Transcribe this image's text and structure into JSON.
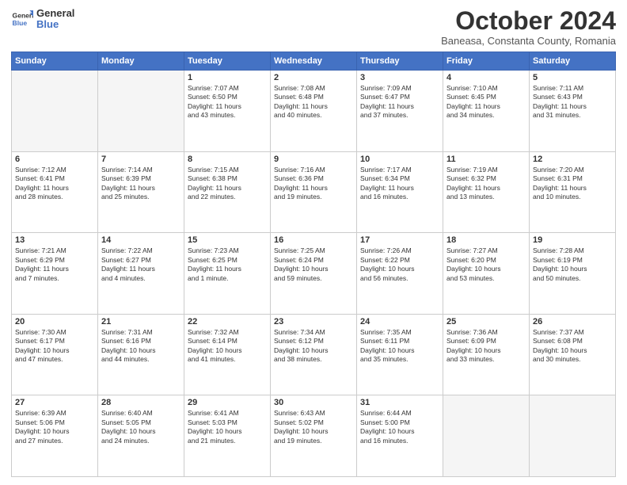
{
  "header": {
    "logo_general": "General",
    "logo_blue": "Blue",
    "month_title": "October 2024",
    "location": "Baneasa, Constanta County, Romania"
  },
  "days_of_week": [
    "Sunday",
    "Monday",
    "Tuesday",
    "Wednesday",
    "Thursday",
    "Friday",
    "Saturday"
  ],
  "weeks": [
    [
      {
        "day": "",
        "empty": true
      },
      {
        "day": "",
        "empty": true
      },
      {
        "day": "1",
        "line1": "Sunrise: 7:07 AM",
        "line2": "Sunset: 6:50 PM",
        "line3": "Daylight: 11 hours",
        "line4": "and 43 minutes."
      },
      {
        "day": "2",
        "line1": "Sunrise: 7:08 AM",
        "line2": "Sunset: 6:48 PM",
        "line3": "Daylight: 11 hours",
        "line4": "and 40 minutes."
      },
      {
        "day": "3",
        "line1": "Sunrise: 7:09 AM",
        "line2": "Sunset: 6:47 PM",
        "line3": "Daylight: 11 hours",
        "line4": "and 37 minutes."
      },
      {
        "day": "4",
        "line1": "Sunrise: 7:10 AM",
        "line2": "Sunset: 6:45 PM",
        "line3": "Daylight: 11 hours",
        "line4": "and 34 minutes."
      },
      {
        "day": "5",
        "line1": "Sunrise: 7:11 AM",
        "line2": "Sunset: 6:43 PM",
        "line3": "Daylight: 11 hours",
        "line4": "and 31 minutes."
      }
    ],
    [
      {
        "day": "6",
        "line1": "Sunrise: 7:12 AM",
        "line2": "Sunset: 6:41 PM",
        "line3": "Daylight: 11 hours",
        "line4": "and 28 minutes."
      },
      {
        "day": "7",
        "line1": "Sunrise: 7:14 AM",
        "line2": "Sunset: 6:39 PM",
        "line3": "Daylight: 11 hours",
        "line4": "and 25 minutes."
      },
      {
        "day": "8",
        "line1": "Sunrise: 7:15 AM",
        "line2": "Sunset: 6:38 PM",
        "line3": "Daylight: 11 hours",
        "line4": "and 22 minutes."
      },
      {
        "day": "9",
        "line1": "Sunrise: 7:16 AM",
        "line2": "Sunset: 6:36 PM",
        "line3": "Daylight: 11 hours",
        "line4": "and 19 minutes."
      },
      {
        "day": "10",
        "line1": "Sunrise: 7:17 AM",
        "line2": "Sunset: 6:34 PM",
        "line3": "Daylight: 11 hours",
        "line4": "and 16 minutes."
      },
      {
        "day": "11",
        "line1": "Sunrise: 7:19 AM",
        "line2": "Sunset: 6:32 PM",
        "line3": "Daylight: 11 hours",
        "line4": "and 13 minutes."
      },
      {
        "day": "12",
        "line1": "Sunrise: 7:20 AM",
        "line2": "Sunset: 6:31 PM",
        "line3": "Daylight: 11 hours",
        "line4": "and 10 minutes."
      }
    ],
    [
      {
        "day": "13",
        "line1": "Sunrise: 7:21 AM",
        "line2": "Sunset: 6:29 PM",
        "line3": "Daylight: 11 hours",
        "line4": "and 7 minutes."
      },
      {
        "day": "14",
        "line1": "Sunrise: 7:22 AM",
        "line2": "Sunset: 6:27 PM",
        "line3": "Daylight: 11 hours",
        "line4": "and 4 minutes."
      },
      {
        "day": "15",
        "line1": "Sunrise: 7:23 AM",
        "line2": "Sunset: 6:25 PM",
        "line3": "Daylight: 11 hours",
        "line4": "and 1 minute."
      },
      {
        "day": "16",
        "line1": "Sunrise: 7:25 AM",
        "line2": "Sunset: 6:24 PM",
        "line3": "Daylight: 10 hours",
        "line4": "and 59 minutes."
      },
      {
        "day": "17",
        "line1": "Sunrise: 7:26 AM",
        "line2": "Sunset: 6:22 PM",
        "line3": "Daylight: 10 hours",
        "line4": "and 56 minutes."
      },
      {
        "day": "18",
        "line1": "Sunrise: 7:27 AM",
        "line2": "Sunset: 6:20 PM",
        "line3": "Daylight: 10 hours",
        "line4": "and 53 minutes."
      },
      {
        "day": "19",
        "line1": "Sunrise: 7:28 AM",
        "line2": "Sunset: 6:19 PM",
        "line3": "Daylight: 10 hours",
        "line4": "and 50 minutes."
      }
    ],
    [
      {
        "day": "20",
        "line1": "Sunrise: 7:30 AM",
        "line2": "Sunset: 6:17 PM",
        "line3": "Daylight: 10 hours",
        "line4": "and 47 minutes."
      },
      {
        "day": "21",
        "line1": "Sunrise: 7:31 AM",
        "line2": "Sunset: 6:16 PM",
        "line3": "Daylight: 10 hours",
        "line4": "and 44 minutes."
      },
      {
        "day": "22",
        "line1": "Sunrise: 7:32 AM",
        "line2": "Sunset: 6:14 PM",
        "line3": "Daylight: 10 hours",
        "line4": "and 41 minutes."
      },
      {
        "day": "23",
        "line1": "Sunrise: 7:34 AM",
        "line2": "Sunset: 6:12 PM",
        "line3": "Daylight: 10 hours",
        "line4": "and 38 minutes."
      },
      {
        "day": "24",
        "line1": "Sunrise: 7:35 AM",
        "line2": "Sunset: 6:11 PM",
        "line3": "Daylight: 10 hours",
        "line4": "and 35 minutes."
      },
      {
        "day": "25",
        "line1": "Sunrise: 7:36 AM",
        "line2": "Sunset: 6:09 PM",
        "line3": "Daylight: 10 hours",
        "line4": "and 33 minutes."
      },
      {
        "day": "26",
        "line1": "Sunrise: 7:37 AM",
        "line2": "Sunset: 6:08 PM",
        "line3": "Daylight: 10 hours",
        "line4": "and 30 minutes."
      }
    ],
    [
      {
        "day": "27",
        "line1": "Sunrise: 6:39 AM",
        "line2": "Sunset: 5:06 PM",
        "line3": "Daylight: 10 hours",
        "line4": "and 27 minutes."
      },
      {
        "day": "28",
        "line1": "Sunrise: 6:40 AM",
        "line2": "Sunset: 5:05 PM",
        "line3": "Daylight: 10 hours",
        "line4": "and 24 minutes."
      },
      {
        "day": "29",
        "line1": "Sunrise: 6:41 AM",
        "line2": "Sunset: 5:03 PM",
        "line3": "Daylight: 10 hours",
        "line4": "and 21 minutes."
      },
      {
        "day": "30",
        "line1": "Sunrise: 6:43 AM",
        "line2": "Sunset: 5:02 PM",
        "line3": "Daylight: 10 hours",
        "line4": "and 19 minutes."
      },
      {
        "day": "31",
        "line1": "Sunrise: 6:44 AM",
        "line2": "Sunset: 5:00 PM",
        "line3": "Daylight: 10 hours",
        "line4": "and 16 minutes."
      },
      {
        "day": "",
        "empty": true
      },
      {
        "day": "",
        "empty": true
      }
    ]
  ]
}
